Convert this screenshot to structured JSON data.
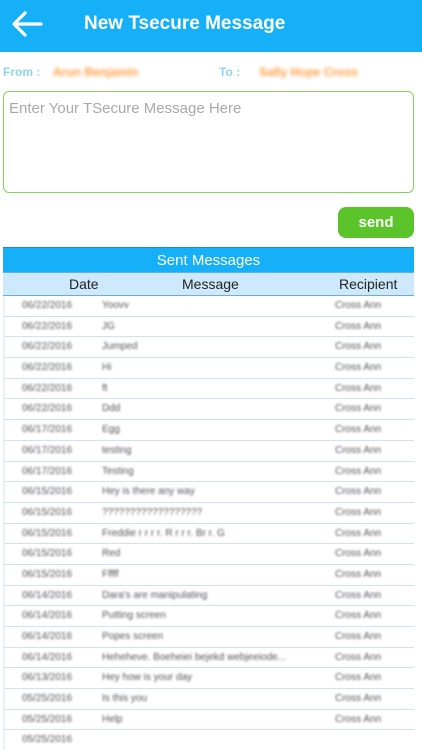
{
  "header": {
    "title": "New Tsecure Message",
    "back_icon": "arrow-left-icon"
  },
  "meta": {
    "from_label": "From :",
    "from_value": "Arun Benjamin",
    "to_label": "To :",
    "to_value": "Sally Hope Cross"
  },
  "compose": {
    "placeholder": "Enter Your TSecure Message Here",
    "value": ""
  },
  "send_label": "send",
  "sent": {
    "title": "Sent Messages",
    "columns": {
      "date": "Date",
      "message": "Message",
      "recipient": "Recipient"
    },
    "rows": [
      {
        "date": "06/22/2016",
        "message": "Yoovv",
        "recipient": "Cross Ann"
      },
      {
        "date": "06/22/2016",
        "message": "JG",
        "recipient": "Cross Ann"
      },
      {
        "date": "06/22/2016",
        "message": "Jumped",
        "recipient": "Cross Ann"
      },
      {
        "date": "06/22/2016",
        "message": "Hi",
        "recipient": "Cross Ann"
      },
      {
        "date": "06/22/2016",
        "message": "ft",
        "recipient": "Cross Ann"
      },
      {
        "date": "06/22/2016",
        "message": "Ddd",
        "recipient": "Cross Ann"
      },
      {
        "date": "06/17/2016",
        "message": "Egg",
        "recipient": "Cross Ann"
      },
      {
        "date": "06/17/2016",
        "message": "testing",
        "recipient": "Cross Ann"
      },
      {
        "date": "06/17/2016",
        "message": "Testing",
        "recipient": "Cross Ann"
      },
      {
        "date": "06/15/2016",
        "message": "Hey is there any way",
        "recipient": "Cross Ann"
      },
      {
        "date": "06/15/2016",
        "message": "??????????????????",
        "recipient": "Cross Ann"
      },
      {
        "date": "06/15/2016",
        "message": "Freddie r r r r. R r r r. Br r. G",
        "recipient": "Cross Ann"
      },
      {
        "date": "06/15/2016",
        "message": "Red",
        "recipient": "Cross Ann"
      },
      {
        "date": "06/15/2016",
        "message": "Fffff",
        "recipient": "Cross Ann"
      },
      {
        "date": "06/14/2016",
        "message": "Dara's are manipulating",
        "recipient": "Cross Ann"
      },
      {
        "date": "06/14/2016",
        "message": "Putting screen",
        "recipient": "Cross Ann"
      },
      {
        "date": "06/14/2016",
        "message": "Popes screen",
        "recipient": "Cross Ann"
      },
      {
        "date": "06/14/2016",
        "message": "Heheheve. Boeheiei bejekd webjeeiode...",
        "recipient": "Cross Ann"
      },
      {
        "date": "06/13/2016",
        "message": "Hey how is your day",
        "recipient": "Cross Ann"
      },
      {
        "date": "05/25/2016",
        "message": "Is this you",
        "recipient": "Cross Ann"
      },
      {
        "date": "05/25/2016",
        "message": "Help",
        "recipient": "Cross Ann"
      },
      {
        "date": "05/25/2016",
        "message": "",
        "recipient": ""
      }
    ]
  },
  "colors": {
    "header_bg": "#16b0f8",
    "send_bg": "#5bc42a",
    "input_border": "#7ed957",
    "name_text": "#ff9c3f",
    "label_text": "#8fd1f5"
  }
}
